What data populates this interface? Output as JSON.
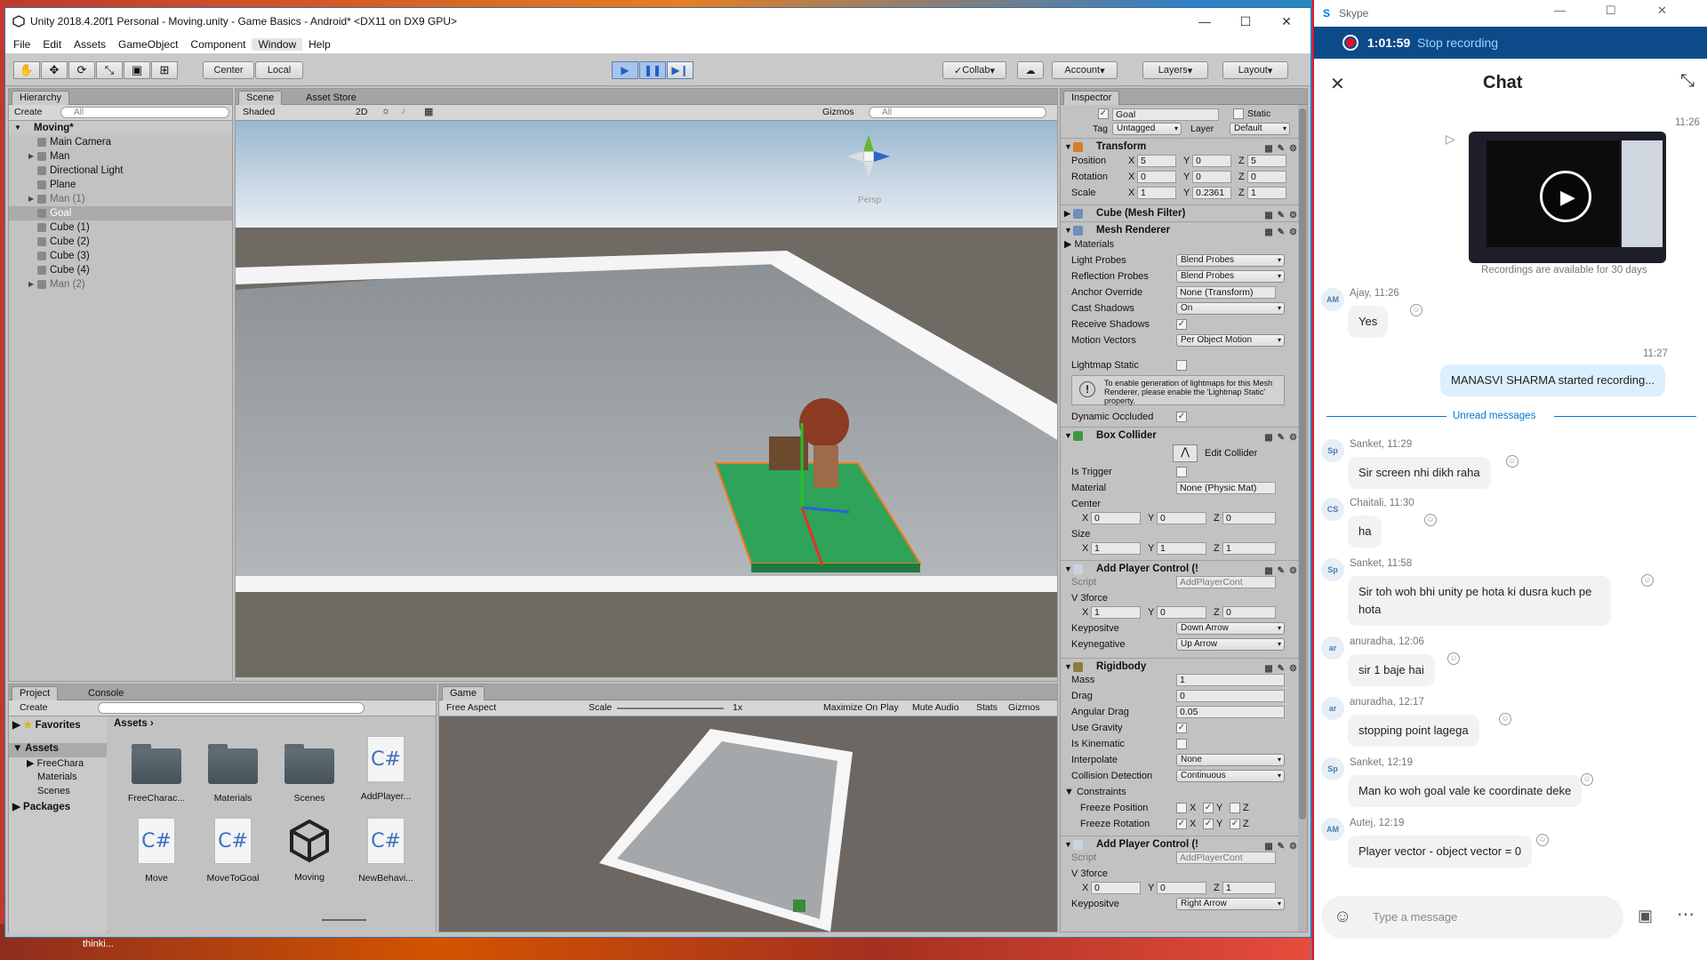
{
  "desktop": {
    "taskbar_snippet": "thinki..."
  },
  "unity": {
    "title": "Unity 2018.4.20f1 Personal - Moving.unity - Game Basics - Android* <DX11 on DX9 GPU>",
    "menu": [
      "File",
      "Edit",
      "Assets",
      "GameObject",
      "Component",
      "Window",
      "Help"
    ],
    "toolbar": {
      "center": "Center",
      "local": "Local",
      "collab": "Collab",
      "account": "Account",
      "layers": "Layers",
      "layout": "Layout"
    },
    "hierarchy": {
      "tab": "Hierarchy",
      "create": "Create",
      "search": "All",
      "scene": "Moving*",
      "items": [
        "Main Camera",
        "Man",
        "Directional Light",
        "Plane",
        "Man (1)",
        "Goal",
        "Cube (1)",
        "Cube (2)",
        "Cube (3)",
        "Cube (4)",
        "Man (2)"
      ]
    },
    "scene": {
      "tab_scene": "Scene",
      "tab_asset_store": "Asset Store",
      "shading": "Shaded",
      "mode2d": "2D",
      "gizmos": "Gizmos",
      "search": "All",
      "persp": "Persp"
    },
    "project": {
      "tab_project": "Project",
      "tab_console": "Console",
      "create": "Create",
      "favorites": "Favorites",
      "assets_root": "Assets",
      "breadcrumb": "Assets",
      "tree": [
        "FreeChara",
        "Materials",
        "Scenes"
      ],
      "packages": "Packages",
      "assets": [
        {
          "name": "FreeCharac...",
          "type": "folder"
        },
        {
          "name": "Materials",
          "type": "folder"
        },
        {
          "name": "Scenes",
          "type": "folder"
        },
        {
          "name": "AddPlayer...",
          "type": "script"
        },
        {
          "name": "Move",
          "type": "script"
        },
        {
          "name": "MoveToGoal",
          "type": "script"
        },
        {
          "name": "Moving",
          "type": "unity"
        },
        {
          "name": "NewBehavi...",
          "type": "script"
        }
      ],
      "cs_label": "C#"
    },
    "game": {
      "tab": "Game",
      "aspect": "Free Aspect",
      "scale_label": "Scale",
      "scale_value": "1x",
      "maximize": "Maximize On Play",
      "mute": "Mute Audio",
      "stats": "Stats",
      "gizmos": "Gizmos"
    },
    "inspector": {
      "tab": "Inspector",
      "object_name": "Goal",
      "static": "Static",
      "tag_label": "Tag",
      "tag": "Untagged",
      "layer_label": "Layer",
      "layer": "Default",
      "transform": {
        "title": "Transform",
        "rows": [
          {
            "label": "Position",
            "x": "5",
            "y": "0",
            "z": "5"
          },
          {
            "label": "Rotation",
            "x": "0",
            "y": "0",
            "z": "0"
          },
          {
            "label": "Scale",
            "x": "1",
            "y": "0.2361",
            "z": "1"
          }
        ]
      },
      "mesh_filter": "Cube (Mesh Filter)",
      "mesh_renderer": {
        "title": "Mesh Renderer",
        "materials": "Materials",
        "light_probes": "Light Probes",
        "light_probes_v": "Blend Probes",
        "reflection_probes": "Reflection Probes",
        "reflection_probes_v": "Blend Probes",
        "anchor": "Anchor Override",
        "anchor_v": "None (Transform)",
        "cast": "Cast Shadows",
        "cast_v": "On",
        "receive": "Receive Shadows",
        "motion": "Motion Vectors",
        "motion_v": "Per Object Motion",
        "lightmap": "Lightmap Static",
        "info": "To enable generation of lightmaps for this Mesh Renderer, please enable the 'Lightmap Static' property.",
        "dynamic": "Dynamic Occluded"
      },
      "box_collider": {
        "title": "Box Collider",
        "edit": "Edit Collider",
        "trigger": "Is Trigger",
        "material": "Material",
        "material_v": "None (Physic Mat)",
        "center": "Center",
        "cx": "0",
        "cy": "0",
        "cz": "0",
        "size": "Size",
        "sx": "1",
        "sy": "1",
        "sz": "1"
      },
      "player1": {
        "title": "Add Player Control (!",
        "script": "Script",
        "script_v": "AddPlayerCont",
        "vforce": "V 3force",
        "vx": "1",
        "vy": "0",
        "vz": "0",
        "kp": "Keypositve",
        "kp_v": "Down Arrow",
        "kn": "Keynegative",
        "kn_v": "Up Arrow"
      },
      "rigidbody": {
        "title": "Rigidbody",
        "mass": "Mass",
        "mass_v": "1",
        "drag": "Drag",
        "drag_v": "0",
        "adrag": "Angular Drag",
        "adrag_v": "0.05",
        "gravity": "Use Gravity",
        "kinematic": "Is Kinematic",
        "interp": "Interpolate",
        "interp_v": "None",
        "coll": "Collision Detection",
        "coll_v": "Continuous",
        "constraints": "Constraints",
        "fpos": "Freeze Position",
        "frot": "Freeze Rotation",
        "x": "X",
        "y": "Y",
        "z": "Z"
      },
      "player2": {
        "title": "Add Player Control (!",
        "script": "Script",
        "script_v": "AddPlayerCont",
        "vforce": "V 3force",
        "vx": "0",
        "vy": "0",
        "vz": "1",
        "kp": "Keypositve",
        "kp_v": "Right Arrow"
      }
    }
  },
  "skype": {
    "app": "Skype",
    "rec_time": "1:01:59",
    "rec_stop": "Stop recording",
    "chat_title": "Chat",
    "video_time": "11:26",
    "video_caption": "Recordings are available for 30 days",
    "unread": "Unread messages",
    "self_time": "11:27",
    "self_msg": "MANASVI SHARMA started recording...",
    "messages": [
      {
        "initials": "AM",
        "meta": "Ajay, 11:26",
        "text": "Yes"
      },
      {
        "initials": "Sp",
        "meta": "Sanket, 11:29",
        "text": "Sir screen nhi dikh raha"
      },
      {
        "initials": "CS",
        "meta": "Chaitali, 11:30",
        "text": "ha"
      },
      {
        "initials": "Sp",
        "meta": "Sanket, 11:58",
        "text": "Sir toh woh bhi unity pe hota ki dusra kuch pe hota"
      },
      {
        "initials": "ar",
        "meta": "anuradha, 12:06",
        "text": "sir 1 baje hai"
      },
      {
        "initials": "ar",
        "meta": "anuradha, 12:17",
        "text": "stopping point lagega"
      },
      {
        "initials": "Sp",
        "meta": "Sanket, 12:19",
        "text": "Man ko woh goal vale ke coordinate deke"
      },
      {
        "initials": "AM",
        "meta": "Autej, 12:19",
        "text": "Player vector - object vector = 0"
      }
    ],
    "input_placeholder": "Type a message",
    "colors": {
      "rec_bar": "#0c4a8a",
      "accent": "#0078d4",
      "record_dot": "#e81123"
    }
  }
}
